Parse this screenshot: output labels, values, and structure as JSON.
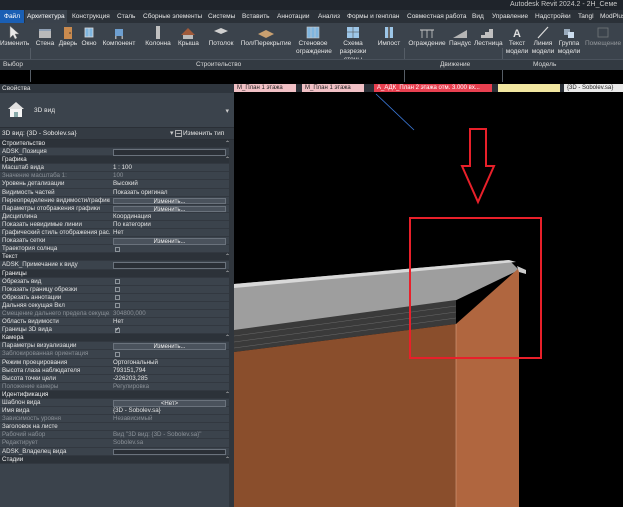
{
  "titlebar": {
    "title": "Autodesk Revit 2024.2 - 2H_Семе"
  },
  "menu": {
    "items": [
      "Файл",
      "Архитектура",
      "Конструкция",
      "Сталь",
      "Сборные элементы",
      "Системы",
      "Вставить",
      "Аннотации",
      "Анализ",
      "Формы и генплан",
      "Совместная работа",
      "Вид",
      "Управление",
      "Надстройки",
      "Tangl",
      "ModPlus"
    ]
  },
  "ribbon": {
    "buttons": [
      "Изменить",
      "Стена",
      "Дверь",
      "Окно",
      "Компонент",
      "Колонна",
      "Крыша",
      "Потолок",
      "Пол/Перекрытие",
      "Стеновое ограждение",
      "Схема разрезки стены",
      "Импост",
      "Ограждение",
      "Пандус",
      "Лестница",
      "Текст модели",
      "Линия модели",
      "Группа модели",
      "Помещение"
    ],
    "panels": [
      "Выбор",
      "Строительство",
      "Движение",
      "Модель"
    ]
  },
  "tabs": [
    "М_План 1 этажа",
    "М_План 1 этажа",
    "А_АДК_План 2 этажа отм. 3.000 вх...",
    "",
    "{3D - Sobolev.sa}"
  ],
  "properties": {
    "header": "Свойства",
    "type_name": "3D вид",
    "instance_selector": "3D вид: {3D - Sobolev.sa}",
    "edit_type": "Изменить тип",
    "rows": [
      {
        "kind": "cat",
        "k": "Строительство"
      },
      {
        "kind": "box",
        "k": "ADSK_Позиция",
        "v": ""
      },
      {
        "kind": "cat",
        "k": "Графика"
      },
      {
        "kind": "val",
        "k": "Масштаб вида",
        "v": "1 : 100"
      },
      {
        "kind": "dim",
        "k": "Значение масштаба    1:",
        "v": "100"
      },
      {
        "kind": "val",
        "k": "Уровень детализации",
        "v": "Высокий"
      },
      {
        "kind": "val",
        "k": "Видимость частей",
        "v": "Показать оригинал"
      },
      {
        "kind": "btn",
        "k": "Переопределение видимости/графики",
        "v": "Изменить..."
      },
      {
        "kind": "btn",
        "k": "Параметры отображения графики",
        "v": "Изменить..."
      },
      {
        "kind": "val",
        "k": "Дисциплина",
        "v": "Координация"
      },
      {
        "kind": "val",
        "k": "Показать невидимые линии",
        "v": "По категории"
      },
      {
        "kind": "val",
        "k": "Графический стиль отображения рас...",
        "v": "Нет"
      },
      {
        "kind": "btn",
        "k": "Показать сетки",
        "v": "Изменить..."
      },
      {
        "kind": "cb",
        "k": "Траектория солнца",
        "checked": false
      },
      {
        "kind": "cat",
        "k": "Текст"
      },
      {
        "kind": "box",
        "k": "ADSK_Примечание к виду",
        "v": ""
      },
      {
        "kind": "cat",
        "k": "Границы"
      },
      {
        "kind": "cb",
        "k": "Обрезать вид",
        "checked": false
      },
      {
        "kind": "cb",
        "k": "Показать границу обрезки",
        "checked": false
      },
      {
        "kind": "cb",
        "k": "Обрезать аннотации",
        "checked": false
      },
      {
        "kind": "cb",
        "k": "Дальняя секущая Вкл",
        "checked": false
      },
      {
        "kind": "dim",
        "k": "Смещение дальнего предела секуще...",
        "v": "304800,000"
      },
      {
        "kind": "val",
        "k": "Область видимости",
        "v": "Нет"
      },
      {
        "kind": "cb",
        "k": "Границы 3D вида",
        "checked": true
      },
      {
        "kind": "cat",
        "k": "Камера"
      },
      {
        "kind": "btn",
        "k": "Параметры визуализации",
        "v": "Изменить..."
      },
      {
        "kind": "cbdim",
        "k": "Заблокированная ориентация",
        "checked": false
      },
      {
        "kind": "val",
        "k": "Режим проецирования",
        "v": "Ортогональный"
      },
      {
        "kind": "val",
        "k": "Высота глаза наблюдателя",
        "v": "793151,794"
      },
      {
        "kind": "val",
        "k": "Высота точки цели",
        "v": "-226203,285"
      },
      {
        "kind": "dim",
        "k": "Положение камеры",
        "v": "Регулировка"
      },
      {
        "kind": "cat",
        "k": "Идентификация"
      },
      {
        "kind": "btn",
        "k": "Шаблон вида",
        "v": "<Нет>"
      },
      {
        "kind": "val",
        "k": "Имя вида",
        "v": "{3D - Sobolev.sa}"
      },
      {
        "kind": "dim",
        "k": "Зависимость уровня",
        "v": "Независимый"
      },
      {
        "kind": "val",
        "k": "Заголовок на листе",
        "v": ""
      },
      {
        "kind": "dim",
        "k": "Рабочий набор",
        "v": "Вид \"3D вид: {3D - Sobolev.sa}\""
      },
      {
        "kind": "dim",
        "k": "Редактирует",
        "v": "Sobolev.sa"
      },
      {
        "kind": "box",
        "k": "ADSK_Владелец вида",
        "v": ""
      },
      {
        "kind": "cat",
        "k": "Стадии"
      }
    ]
  },
  "colors": {
    "ribbon_bg": "#3b434c",
    "accent_blue": "#1a5fb4",
    "highlight_red": "#e8202a",
    "wall_brown": "#b0663f"
  }
}
